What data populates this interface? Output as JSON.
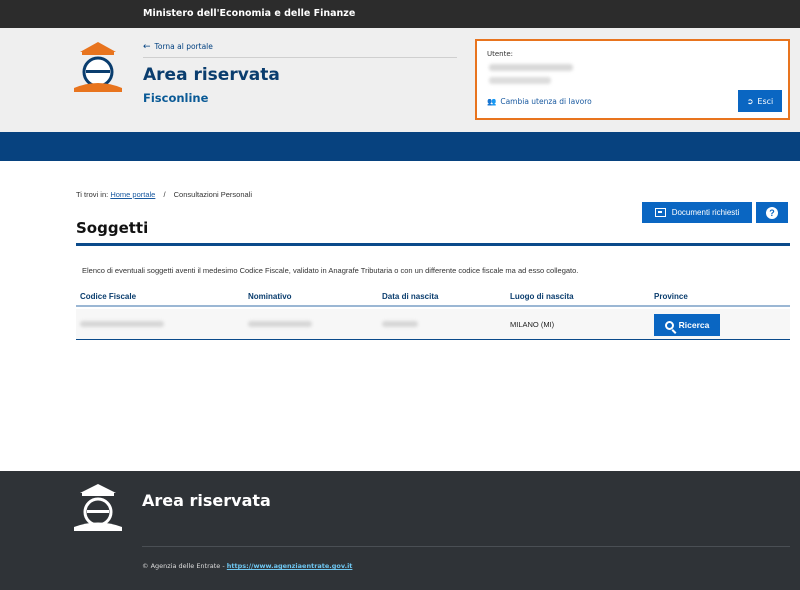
{
  "top_bar": {
    "ministry": "Ministero dell'Economia e delle Finanze"
  },
  "header": {
    "back_link": "Torna al portale",
    "title": "Area riservata",
    "subtitle": "Fisconline",
    "user_box": {
      "label": "Utente:",
      "change_link": "Cambia utenza di lavoro",
      "logout_label": "Esci"
    }
  },
  "breadcrumb": {
    "prefix": "Ti trovi in:",
    "home": "Home portale",
    "separator": "/",
    "current": "Consultazioni Personali"
  },
  "actions": {
    "documents_label": "Documenti richiesti",
    "help_label": "?"
  },
  "main": {
    "title": "Soggetti",
    "description": "Elenco di eventuali soggetti aventi il medesimo Codice Fiscale, validato in Anagrafe Tributaria o con un differente codice fiscale ma ad esso collegato.",
    "table": {
      "headers": [
        "Codice Fiscale",
        "Nominativo",
        "Data di nascita",
        "Luogo di nascita",
        "Province"
      ],
      "rows": [
        {
          "luogo": "MILANO (MI)",
          "action": "Ricerca"
        }
      ]
    }
  },
  "footer": {
    "title": "Area riservata",
    "copyright": "© Agenzia delle Entrate - ",
    "link": "https://www.agenziaentrate.gov.it"
  },
  "colors": {
    "brand_blue": "#07427f",
    "button_blue": "#0a66c2",
    "user_box_border": "#e8741e",
    "footer_bg": "#2f3337"
  }
}
